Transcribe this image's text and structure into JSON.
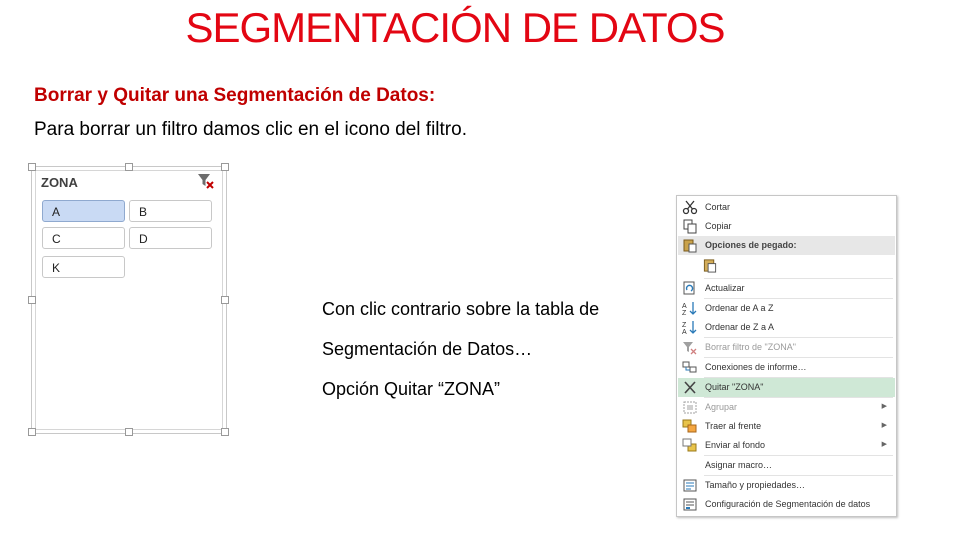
{
  "title": "SEGMENTACIÓN DE DATOS",
  "subtitle": "Borrar y Quitar una Segmentación de Datos:",
  "body_text": "Para borrar un filtro  damos clic en el icono del filtro.",
  "slicer": {
    "title": "ZONA",
    "items": [
      {
        "label": "A",
        "selected": true
      },
      {
        "label": "B",
        "selected": false
      },
      {
        "label": "C",
        "selected": false
      },
      {
        "label": "D",
        "selected": false
      },
      {
        "label": "K",
        "selected": false
      }
    ],
    "colors": {
      "selected": "#c9daf4",
      "filter_x": "#c00000"
    }
  },
  "caption": {
    "line1": "Con clic contrario sobre la tabla de",
    "line2": "Segmentación de Datos…",
    "line3": "Opción Quitar “ZONA”"
  },
  "context_menu": {
    "items": [
      {
        "label": "Cortar",
        "icon": "scissors-icon"
      },
      {
        "label": "Copiar",
        "icon": "copy-icon"
      },
      {
        "label": "Opciones de pegado:",
        "icon": "paste-icon"
      },
      {
        "label": "",
        "icon": "clipboard-icon"
      },
      {
        "label": "Actualizar",
        "icon": "refresh-icon"
      },
      {
        "label": "Ordenar de A a Z",
        "icon": "sort-az-icon"
      },
      {
        "label": "Ordenar de Z a A",
        "icon": "sort-za-icon"
      },
      {
        "label": "Borrar filtro de \"ZONA\"",
        "icon": "clear-filter-icon"
      },
      {
        "label": "Conexiones de informe…",
        "icon": "report-connections-icon"
      },
      {
        "label": "Quitar \"ZONA\"",
        "icon": "remove-x-icon"
      },
      {
        "label": "Agrupar",
        "icon": "group-icon"
      },
      {
        "label": "Traer al frente",
        "icon": "bring-front-icon"
      },
      {
        "label": "Enviar al fondo",
        "icon": "send-back-icon"
      },
      {
        "label": "Asignar macro…",
        "icon": ""
      },
      {
        "label": "Tamaño y propiedades…",
        "icon": "size-properties-icon"
      },
      {
        "label": "Configuración de Segmentación de datos",
        "icon": "slicer-settings-icon"
      }
    ],
    "colors": {
      "highlight": "#cfe8d6"
    }
  }
}
